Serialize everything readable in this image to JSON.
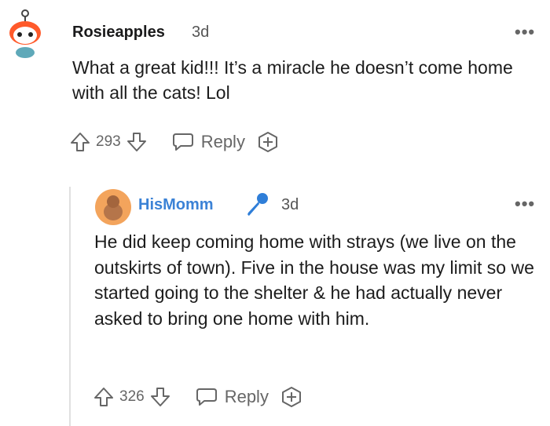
{
  "comment": {
    "username": "Rosieapples",
    "age": "3d",
    "more": "•••",
    "text": "What a great kid!!! It’s a miracle he doesn’t come home with all the cats! Lol",
    "votes": "293",
    "reply_label": "Reply"
  },
  "reply": {
    "username": "HisMomm",
    "age": "3d",
    "more": "•••",
    "text": "He did keep coming home with strays (we live on the outskirts of town). Five in the house was my limit so we started going to the shelter & he had actually never asked to bring one home with him.",
    "votes": "326",
    "reply_label": "Reply"
  },
  "colors": {
    "username_reply": "#3b82d6",
    "meta_gray": "#666666",
    "mic_blue": "#2f7ed8"
  },
  "icons": {
    "upvote": "upvote-arrow-icon",
    "downvote": "downvote-arrow-icon",
    "reply": "speech-bubble-icon",
    "award": "add-award-icon",
    "flair": "microphone-icon"
  }
}
